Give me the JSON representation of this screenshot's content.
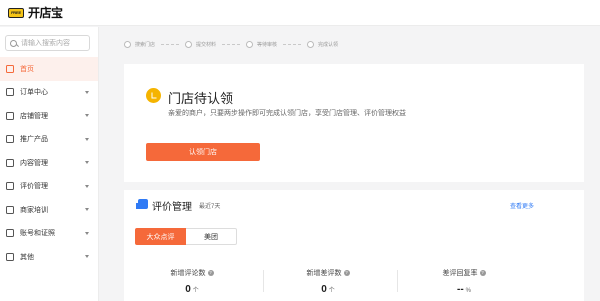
{
  "brand": {
    "badge": "FREE",
    "name": "开店宝"
  },
  "sidebar": {
    "search_placeholder": "请输入搜索内容",
    "items": [
      {
        "label": "首页",
        "icon": "home-icon",
        "active": true
      },
      {
        "label": "订单中心",
        "icon": "order-icon"
      },
      {
        "label": "店铺管理",
        "icon": "store-icon"
      },
      {
        "label": "推广产品",
        "icon": "promotion-icon"
      },
      {
        "label": "内容管理",
        "icon": "content-icon"
      },
      {
        "label": "评价管理",
        "icon": "review-icon"
      },
      {
        "label": "商家培训",
        "icon": "training-icon"
      },
      {
        "label": "账号和证照",
        "icon": "account-icon"
      },
      {
        "label": "其他",
        "icon": "other-icon"
      }
    ]
  },
  "stepper": {
    "steps": [
      "搜索门店",
      "提交材料",
      "等待审核",
      "完成认领"
    ]
  },
  "claim_card": {
    "title": "门店待认领",
    "description": "亲爱的商户，只要两步操作即可完成认领门店，享受门店管理、评价管理权益",
    "button": "认领门店"
  },
  "review_card": {
    "title": "评价管理",
    "subtitle": "最近7天",
    "more": "查看更多",
    "tabs": [
      "大众点评",
      "美团"
    ],
    "stats": [
      {
        "label": "新增评论数",
        "value": "0",
        "unit": "个"
      },
      {
        "label": "新增差评数",
        "value": "0",
        "unit": "个"
      },
      {
        "label": "差评回复率",
        "value": "--",
        "unit": "%"
      }
    ]
  },
  "colors": {
    "accent": "#f5693a",
    "link": "#2f7af5",
    "bell": "#f5b400"
  }
}
